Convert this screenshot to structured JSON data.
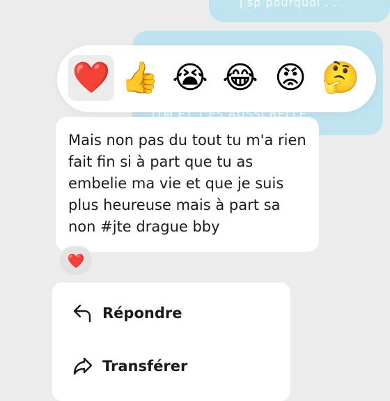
{
  "background_messages": {
    "top_text": "j'sp pourquoi . . .",
    "mid_text": "JTM ET T'ES AUSSI BELLE"
  },
  "reaction_bar": {
    "emojis": [
      {
        "glyph": "❤️",
        "name": "red-heart",
        "selected": true
      },
      {
        "glyph": "👍",
        "name": "thumbs-up",
        "selected": false
      },
      {
        "glyph": "😭",
        "name": "loudly-crying-face",
        "selected": false
      },
      {
        "glyph": "😂",
        "name": "face-with-tears-of-joy",
        "selected": false
      },
      {
        "glyph": "😡",
        "name": "angry-face",
        "selected": false
      },
      {
        "glyph": "🤔",
        "name": "thinking-face",
        "selected": false
      }
    ]
  },
  "message": {
    "text": "Mais non pas du tout tu m'a rien fait fin si à part que tu as embelie ma vie et que je suis plus heureuse mais à part sa non #jte drague bby"
  },
  "reaction_badge": {
    "glyph": "❤️"
  },
  "context_menu": {
    "reply_label": "Répondre",
    "forward_label": "Transférer"
  },
  "colors": {
    "background": "#ececec",
    "sent_bubble": "#bfe3ef",
    "surface": "#ffffff",
    "text": "#1a1a1a"
  }
}
